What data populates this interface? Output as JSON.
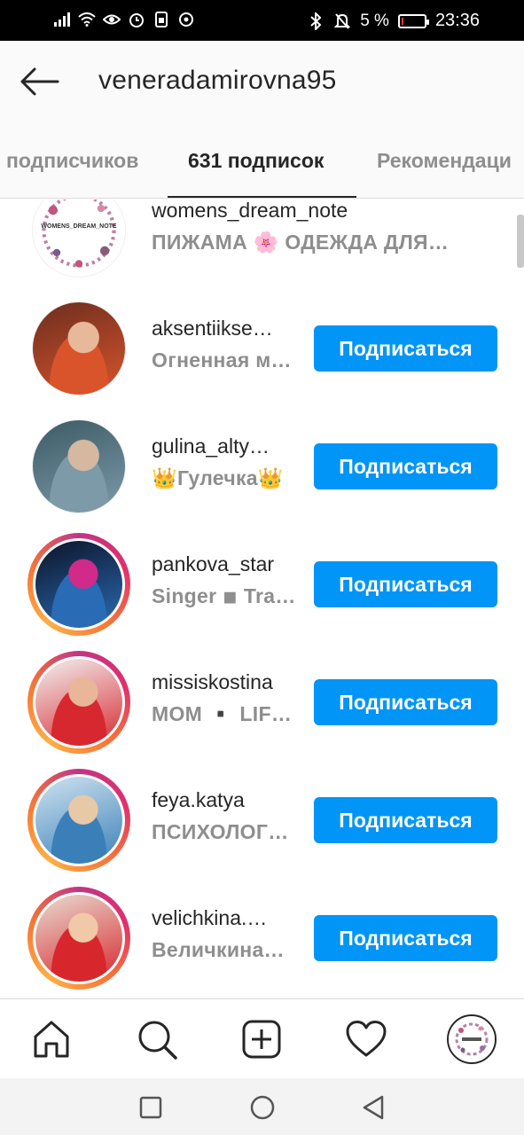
{
  "status_bar": {
    "battery_text": "5 %",
    "battery_level": 0.05,
    "time": "23:36"
  },
  "header": {
    "title": "veneradamirovna95"
  },
  "tabs": [
    {
      "label": "подписчиков",
      "active": false
    },
    {
      "label": "631 подписок",
      "active": true
    },
    {
      "label": "Рекомендаци",
      "active": false
    }
  ],
  "follow_label": "Подписаться",
  "users": [
    {
      "username": "womens_dream_note",
      "subtitle": "ПИЖАМА 🌸 ОДЕЖДА ДЛЯ…",
      "has_story": false,
      "follow_button": false,
      "avatar_colors": [
        "#ffffff",
        "#c07fa6",
        "#8a5a7a"
      ],
      "avatar_text": "WOMENS_DREAM_NOTE"
    },
    {
      "username": "aksentiikse…",
      "subtitle": "Огненная м…",
      "has_story": false,
      "follow_button": true,
      "avatar_colors": [
        "#6b2e1f",
        "#d9542b",
        "#e8b89a"
      ]
    },
    {
      "username": "gulina_alty…",
      "subtitle": "👑Гулечка👑",
      "has_story": false,
      "follow_button": true,
      "avatar_colors": [
        "#3d5a66",
        "#7c9aa8",
        "#d4b8a0"
      ]
    },
    {
      "username": "pankova_star",
      "subtitle": "Singer ◾ Tra…",
      "has_story": true,
      "follow_button": true,
      "avatar_colors": [
        "#0d1428",
        "#2a6bb5",
        "#d12a8a"
      ]
    },
    {
      "username": "missiskostina",
      "subtitle": "MOM ▪️ LIF…",
      "has_story": true,
      "follow_button": true,
      "avatar_colors": [
        "#f2f2f2",
        "#d7282f",
        "#e9b69a"
      ]
    },
    {
      "username": "feya.katya",
      "subtitle": "ПСИХОЛОГ…",
      "has_story": true,
      "follow_button": true,
      "avatar_colors": [
        "#cfe3f0",
        "#3a7fb8",
        "#e7c9a8"
      ]
    },
    {
      "username": "velichkina.…",
      "subtitle": "Величкина…",
      "has_story": true,
      "follow_button": true,
      "avatar_colors": [
        "#e8dcd0",
        "#d8262d",
        "#f1c9a8"
      ]
    }
  ],
  "icons": {
    "back": "arrow-left-icon",
    "home": "home-icon",
    "search": "search-icon",
    "add": "add-post-icon",
    "activity": "heart-icon",
    "profile": "profile-avatar"
  }
}
